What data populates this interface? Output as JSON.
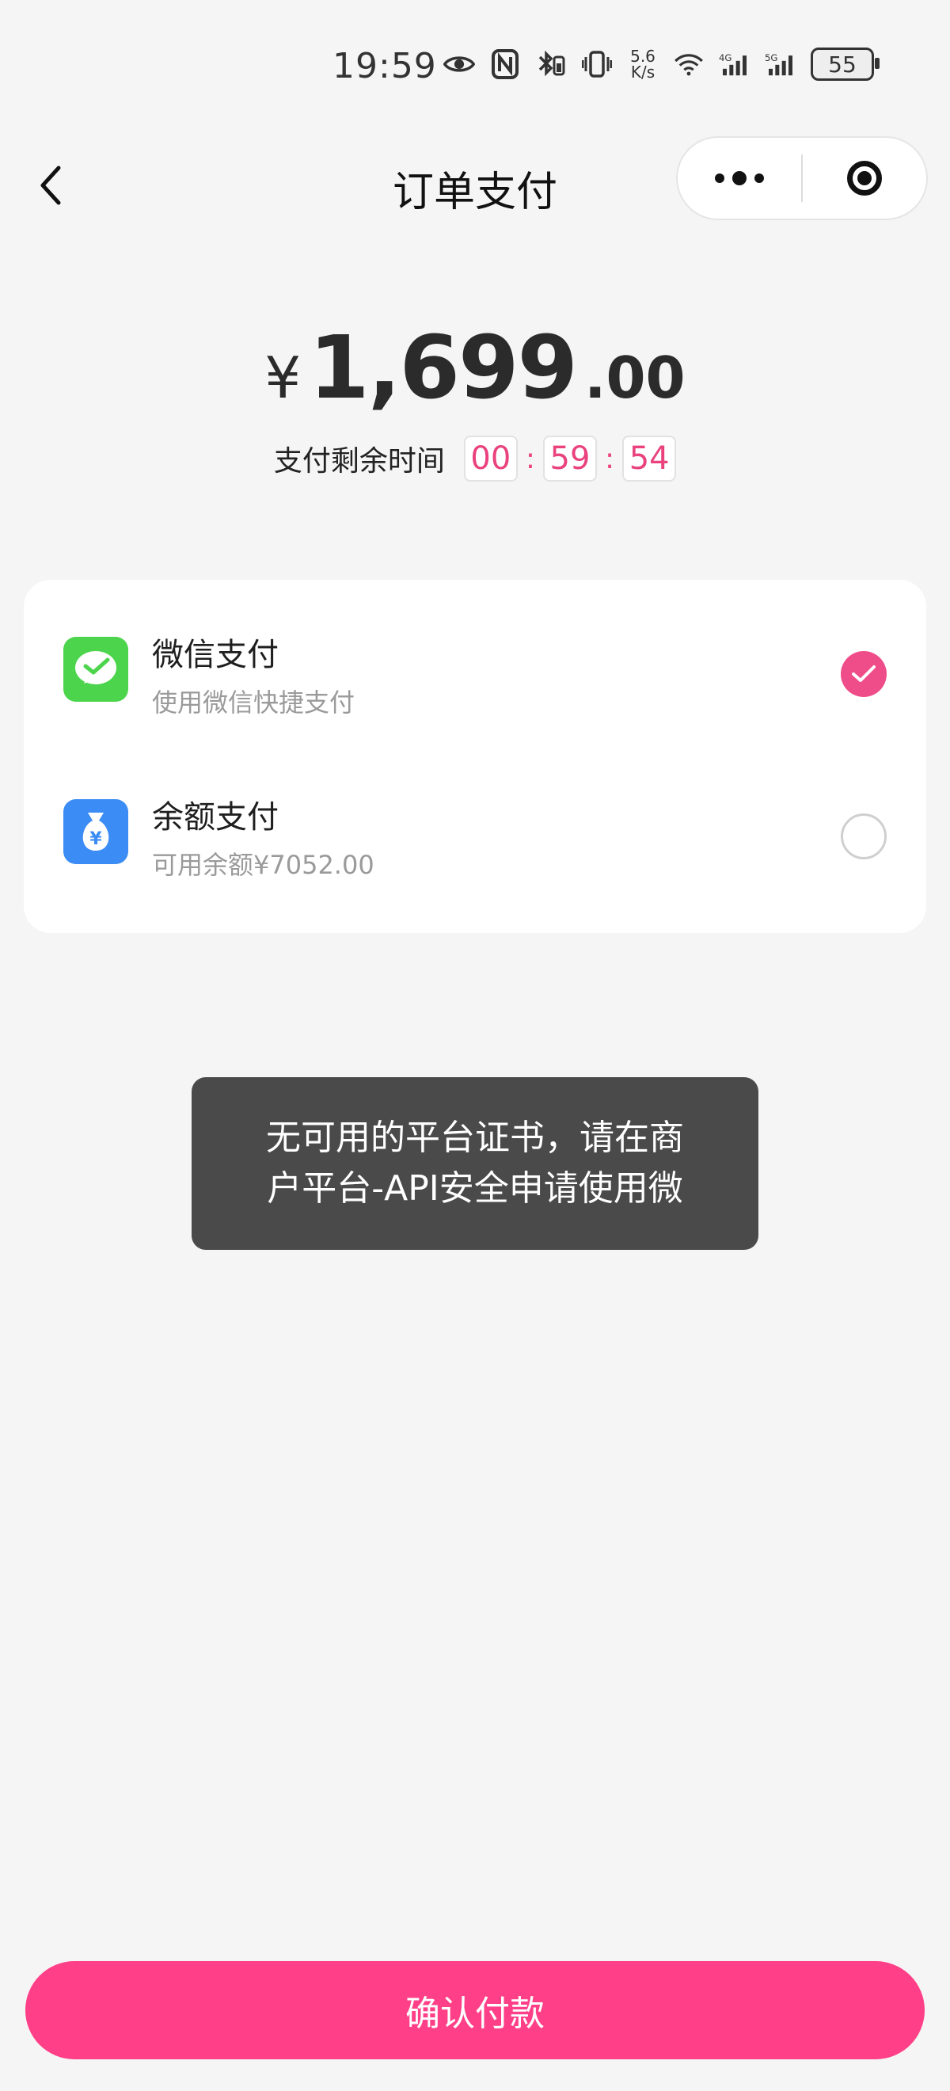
{
  "status_bar": {
    "time": "19:59",
    "net_speed_top": "5.6",
    "net_speed_bottom": "K/s",
    "battery": "55",
    "icons": [
      "eye-icon",
      "nfc-icon",
      "bluetooth-icon",
      "vibrate-icon",
      "wifi-6-icon",
      "signal-4g-icon",
      "signal-5g-icon"
    ]
  },
  "header": {
    "title": "订单支付",
    "icons": {
      "back": "chevron-left-icon",
      "more": "more-dots-icon",
      "close": "target-ring-icon"
    }
  },
  "amount": {
    "currency": "¥",
    "integer": "1,699",
    "decimal": ".00"
  },
  "countdown": {
    "label": "支付剩余时间",
    "hours": "00",
    "minutes": "59",
    "seconds": "54",
    "separator": ":"
  },
  "payment_methods": [
    {
      "title": "微信支付",
      "subtitle": "使用微信快捷支付",
      "selected": true,
      "icon": "wechat-pay-icon",
      "color": "#4cd54c"
    },
    {
      "title": "余额支付",
      "subtitle": "可用余额¥7052.00",
      "selected": false,
      "icon": "money-bag-icon",
      "color": "#3b8cf5"
    }
  ],
  "toast": {
    "line1": "无可用的平台证书，请在商",
    "line2": "户平台-API安全申请使用微"
  },
  "footer": {
    "confirm_label": "确认付款"
  },
  "colors": {
    "accent": "#ff3f87",
    "check": "#ef4c8a",
    "countdown": "#e9427d",
    "toast_bg": "#4a4a4a",
    "page_bg": "#f5f5f5"
  }
}
